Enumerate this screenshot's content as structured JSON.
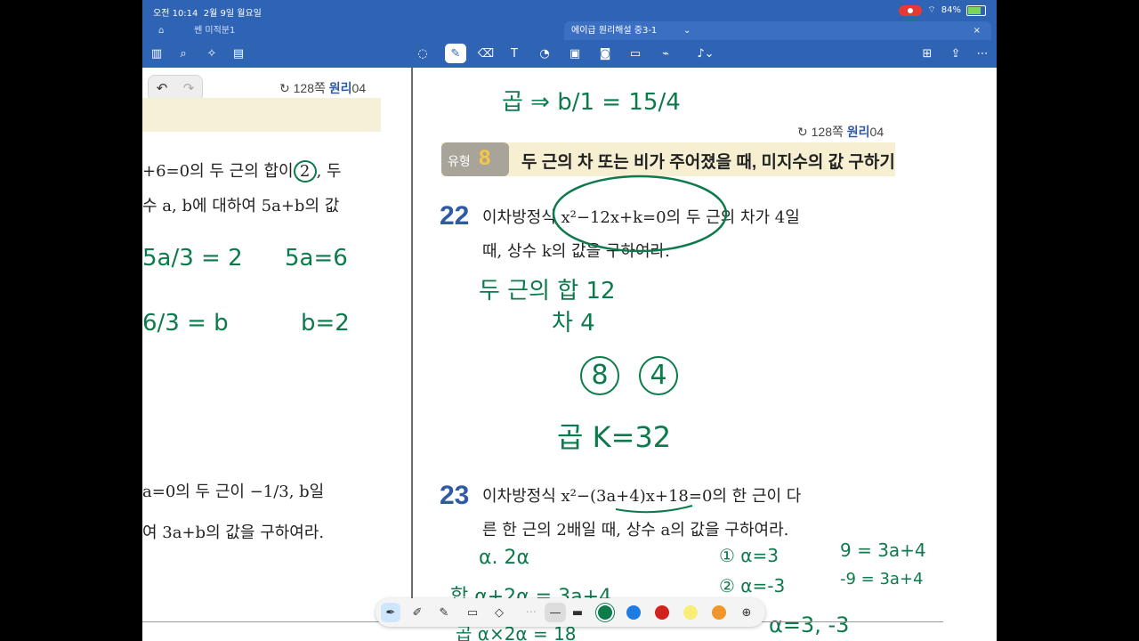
{
  "status": {
    "time": "오전 10:14",
    "date": "2월 9일 월요일",
    "battery": "84%"
  },
  "tabs": [
    {
      "label": "쎈 미적분1",
      "close": "×"
    },
    {
      "label": "에이급 원리해설 중3-1",
      "close": "×"
    }
  ],
  "left_page": {
    "ref_prefix": "128쪽",
    "ref_word": "원리",
    "ref_num": "04",
    "line1": "+6=0의 두 근의 합이",
    "line1_circled": "2",
    "line1_tail": ", 두",
    "line2": "수 a, b에 대하여 5a+b의 값",
    "line3": "a=0의 두 근이 −1/3, b일",
    "line4": "여 3a+b의 값을 구하여라."
  },
  "right_page": {
    "ref_prefix": "128쪽",
    "ref_word": "원리",
    "ref_num": "04",
    "type_word": "유형",
    "type_num": "8",
    "type_title": "두 근의 차 또는 비가 주어졌을 때, 미지수의 값 구하기",
    "p22_num": "22",
    "p22_line1": "이차방정식 x²−12x+k=0의 두 근의 차가 4일",
    "p22_line2": "때, 상수 k의 값을 구하여라.",
    "p23_num": "23",
    "p23_line1": "이차방정식 x²−(3a+4)x+18=0의 한 근이 다",
    "p23_line2": "른 한 근의 2배일 때, 상수 a의 값을 구하여라."
  },
  "handwriting": {
    "left_frac1": "5a/3 = 2",
    "left_eq1": "5a=6",
    "left_frac2": "6/3 = b",
    "left_eq2": "b=2",
    "top_product": "곱 ⇒ b/1 = 15/4",
    "sum_line": "두 근의 합   12",
    "diff_line": "차   4",
    "circled_a": "8",
    "circled_b": "4",
    "product_line": "곱   K=32",
    "roots_line": "α.  2α",
    "case1": "① α=3",
    "case2": "② α=-3",
    "rhs1": "9 = 3a+4",
    "rhs2": "-9 = 3a+4",
    "sum_eq": "합  α+2α = 3a+4",
    "prod_eq": "곱  α×2α = 18",
    "alpha_eq": "α=3, -3"
  },
  "colors": {
    "ink": "#0d7a4c",
    "palette": [
      "#0d7a4c",
      "#1e7be0",
      "#d0231e",
      "#f7ee7a",
      "#f0962a"
    ]
  },
  "icons": {
    "toolbar_left": [
      "book-icon",
      "search-icon",
      "sparkle-icon",
      "document-icon"
    ],
    "toolbar_center": [
      "lasso-icon",
      "pen-icon",
      "eraser-icon",
      "text-box-icon",
      "shape-icon",
      "image-icon",
      "sticker-icon",
      "link-icon",
      "mic-icon"
    ],
    "toolbar_right": [
      "add-page-icon",
      "share-icon",
      "more-icon"
    ]
  }
}
